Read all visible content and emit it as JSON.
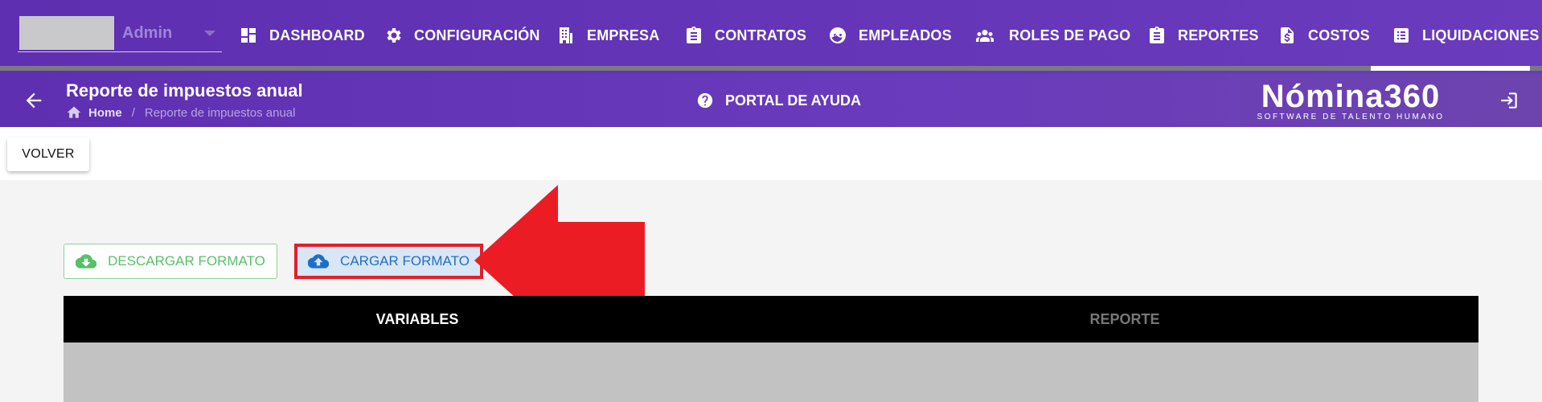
{
  "header": {
    "company_placeholder_hidden": true,
    "role": "Admin",
    "nav": [
      {
        "label": "DASHBOARD",
        "icon": "dashboard-icon"
      },
      {
        "label": "CONFIGURACIÓN",
        "icon": "gear-icon"
      },
      {
        "label": "EMPRESA",
        "icon": "building-icon"
      },
      {
        "label": "CONTRATOS",
        "icon": "clipboard-icon"
      },
      {
        "label": "EMPLEADOS",
        "icon": "face-icon"
      },
      {
        "label": "ROLES DE PAGO",
        "icon": "people-icon"
      },
      {
        "label": "REPORTES",
        "icon": "clipboard-icon"
      },
      {
        "label": "COSTOS",
        "icon": "invoice-dollar-icon"
      },
      {
        "label": "LIQUIDACIONES",
        "icon": "list-icon"
      }
    ],
    "active_nav": "LIQUIDACIONES"
  },
  "subheader": {
    "title": "Reporte de impuestos anual",
    "breadcrumb_home": "Home",
    "breadcrumb_current": "Reporte de impuestos anual",
    "help_label": "PORTAL DE AYUDA",
    "brand_name": "Nómina360",
    "brand_tagline": "SOFTWARE DE TALENTO HUMANO"
  },
  "toolbar": {
    "back_label": "VOLVER"
  },
  "main": {
    "download_label": "DESCARGAR FORMATO",
    "upload_label": "CARGAR FORMATO",
    "tabs": [
      {
        "label": "VARIABLES",
        "active": true
      },
      {
        "label": "REPORTE",
        "active": false
      }
    ]
  },
  "colors": {
    "nav_purple": "#5e2fb0",
    "highlight_red": "#e0202a",
    "download_green": "#58c068",
    "upload_blue": "#1f6fc9"
  }
}
